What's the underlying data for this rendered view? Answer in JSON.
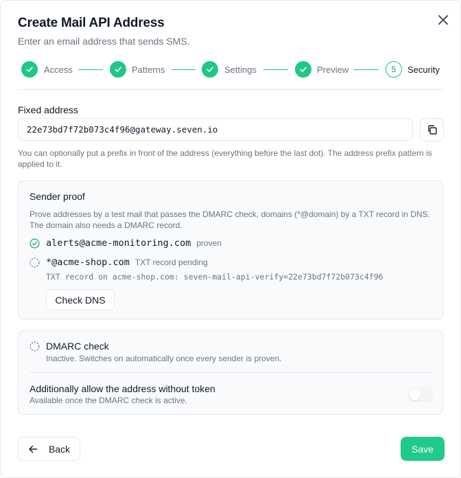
{
  "dialog": {
    "title": "Create Mail API Address",
    "subtitle": "Enter an email address that sends SMS."
  },
  "stepper": {
    "steps": [
      {
        "label": "Access",
        "state": "done"
      },
      {
        "label": "Patterns",
        "state": "done"
      },
      {
        "label": "Settings",
        "state": "done"
      },
      {
        "label": "Preview",
        "state": "done"
      },
      {
        "label": "Security",
        "state": "current",
        "number": "5"
      }
    ]
  },
  "fixed_address": {
    "label": "Fixed address",
    "value": "22e73bd7f72b073c4f96@gateway.seven.io",
    "hint": "You can optionally put a prefix in front of the address (everything before the last dot). The address prefix pattern is applied to it."
  },
  "sender_proof": {
    "title": "Sender proof",
    "description": "Prove addresses by a test mail that passes the DMARC check, domains (*@domain) by a TXT record in DNS. The domain also needs a DMARC record.",
    "senders": [
      {
        "address": "alerts@acme-monitoring.com",
        "status": "proven"
      },
      {
        "address": "*@acme-shop.com",
        "status": "TXT record pending"
      }
    ],
    "txt_record": "TXT record on acme-shop.com: seven-mail-api-verify=22e73bd7f72b073c4f96",
    "check_dns_label": "Check DNS"
  },
  "dmarc": {
    "title": "DMARC check",
    "description": "Inactive. Switches on automatically once every sender is proven.",
    "allow_title": "Additionally allow the address without token",
    "allow_description": "Available once the DMARC check is active.",
    "allow_enabled": false
  },
  "footer": {
    "back_label": "Back",
    "save_label": "Save"
  },
  "colors": {
    "accent": "#21c98c",
    "muted_text": "#6b7280"
  }
}
